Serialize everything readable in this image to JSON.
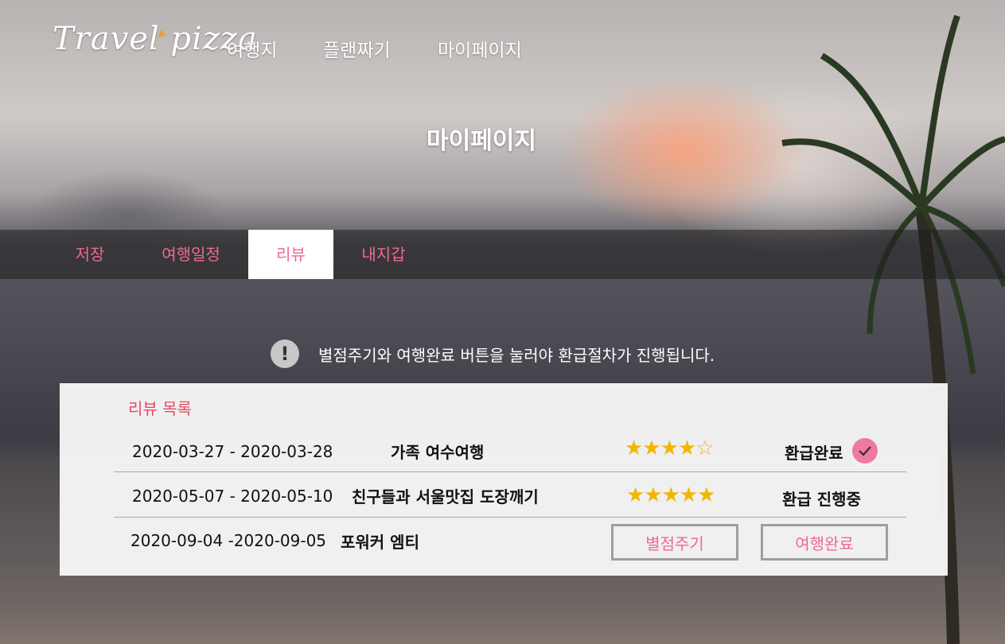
{
  "header": {
    "logo": "Travel pizza",
    "nav": [
      {
        "label": "여행지"
      },
      {
        "label": "플랜짜기"
      },
      {
        "label": "마이페이지"
      }
    ],
    "page_title": "마이페이지"
  },
  "tabs": [
    {
      "label": "저장",
      "active": false
    },
    {
      "label": "여행일정",
      "active": false
    },
    {
      "label": "리뷰",
      "active": true
    },
    {
      "label": "내지갑",
      "active": false
    }
  ],
  "notice": {
    "icon": "exclamation-icon",
    "text": "별점주기와 여행완료 버튼을 눌러야 환급절차가 진행됩니다."
  },
  "reviews": {
    "title": "리뷰 목록",
    "rows": [
      {
        "dates": "2020-03-27 - 2020-03-28",
        "trip": "가족 여수여행",
        "stars": "★★★★☆",
        "status": "환급완료",
        "status_icon": "check-icon"
      },
      {
        "dates": "2020-05-07 - 2020-05-10",
        "trip": "친구들과 서울맛집 도장깨기",
        "stars": "★★★★★",
        "status": "환급 진행중"
      },
      {
        "dates": "2020-09-04  -2020-09-05",
        "trip": "포워커 엠티",
        "rate_button": "별점주기",
        "complete_button": "여행완료"
      }
    ]
  },
  "colors": {
    "accent": "#f06a8c",
    "title_red": "#e84a5f",
    "star": "#f2b600",
    "check_bg": "#ef7aa0"
  }
}
